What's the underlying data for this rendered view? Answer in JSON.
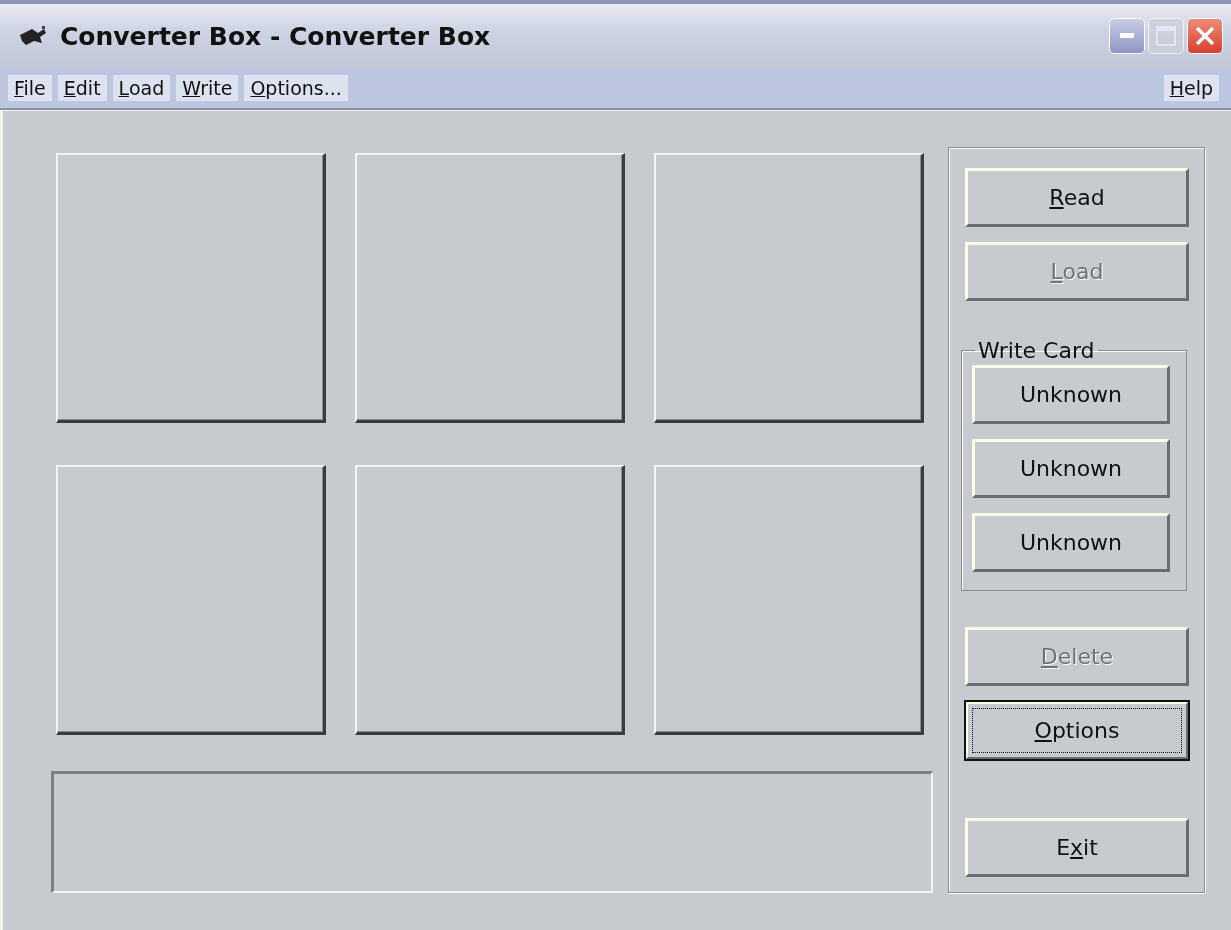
{
  "window": {
    "title": "Converter Box - Converter Box",
    "controls": [
      {
        "kind": "minimize",
        "disabled": false
      },
      {
        "kind": "maximize",
        "disabled": true
      },
      {
        "kind": "close",
        "disabled": false
      }
    ]
  },
  "menu": {
    "items": [
      {
        "key": "F",
        "rest": "ile"
      },
      {
        "key": "E",
        "rest": "dit"
      },
      {
        "key": "L",
        "rest": "oad"
      },
      {
        "key": "W",
        "rest": "rite"
      },
      {
        "key": "O",
        "rest": "ptions..."
      }
    ],
    "help": {
      "key": "H",
      "rest": "elp"
    }
  },
  "slots": [
    {
      "kind": "panel"
    },
    {
      "kind": "panel"
    },
    {
      "kind": "panel"
    },
    {
      "kind": "panel"
    },
    {
      "kind": "panel"
    },
    {
      "kind": "panel"
    }
  ],
  "top_buttons": [
    {
      "key": "R",
      "rest": "ead",
      "disabled": false,
      "focused": false
    },
    {
      "key": "L",
      "rest": "oad",
      "disabled": true,
      "focused": false
    }
  ],
  "write_card": {
    "title": "Write Card",
    "buttons": [
      {
        "rest": "Unknown",
        "disabled": false,
        "focused": false
      },
      {
        "rest": "Unknown",
        "disabled": false,
        "focused": false
      },
      {
        "rest": "Unknown",
        "disabled": false,
        "focused": false
      }
    ]
  },
  "bottom_buttons": [
    {
      "key": "D",
      "rest": "elete",
      "disabled": true,
      "focused": false
    },
    {
      "key": "O",
      "rest": "ptions",
      "disabled": false,
      "focused": true
    }
  ],
  "exit_button": {
    "pre": "E",
    "key": "x",
    "rest": "it",
    "disabled": false,
    "focused": false
  }
}
